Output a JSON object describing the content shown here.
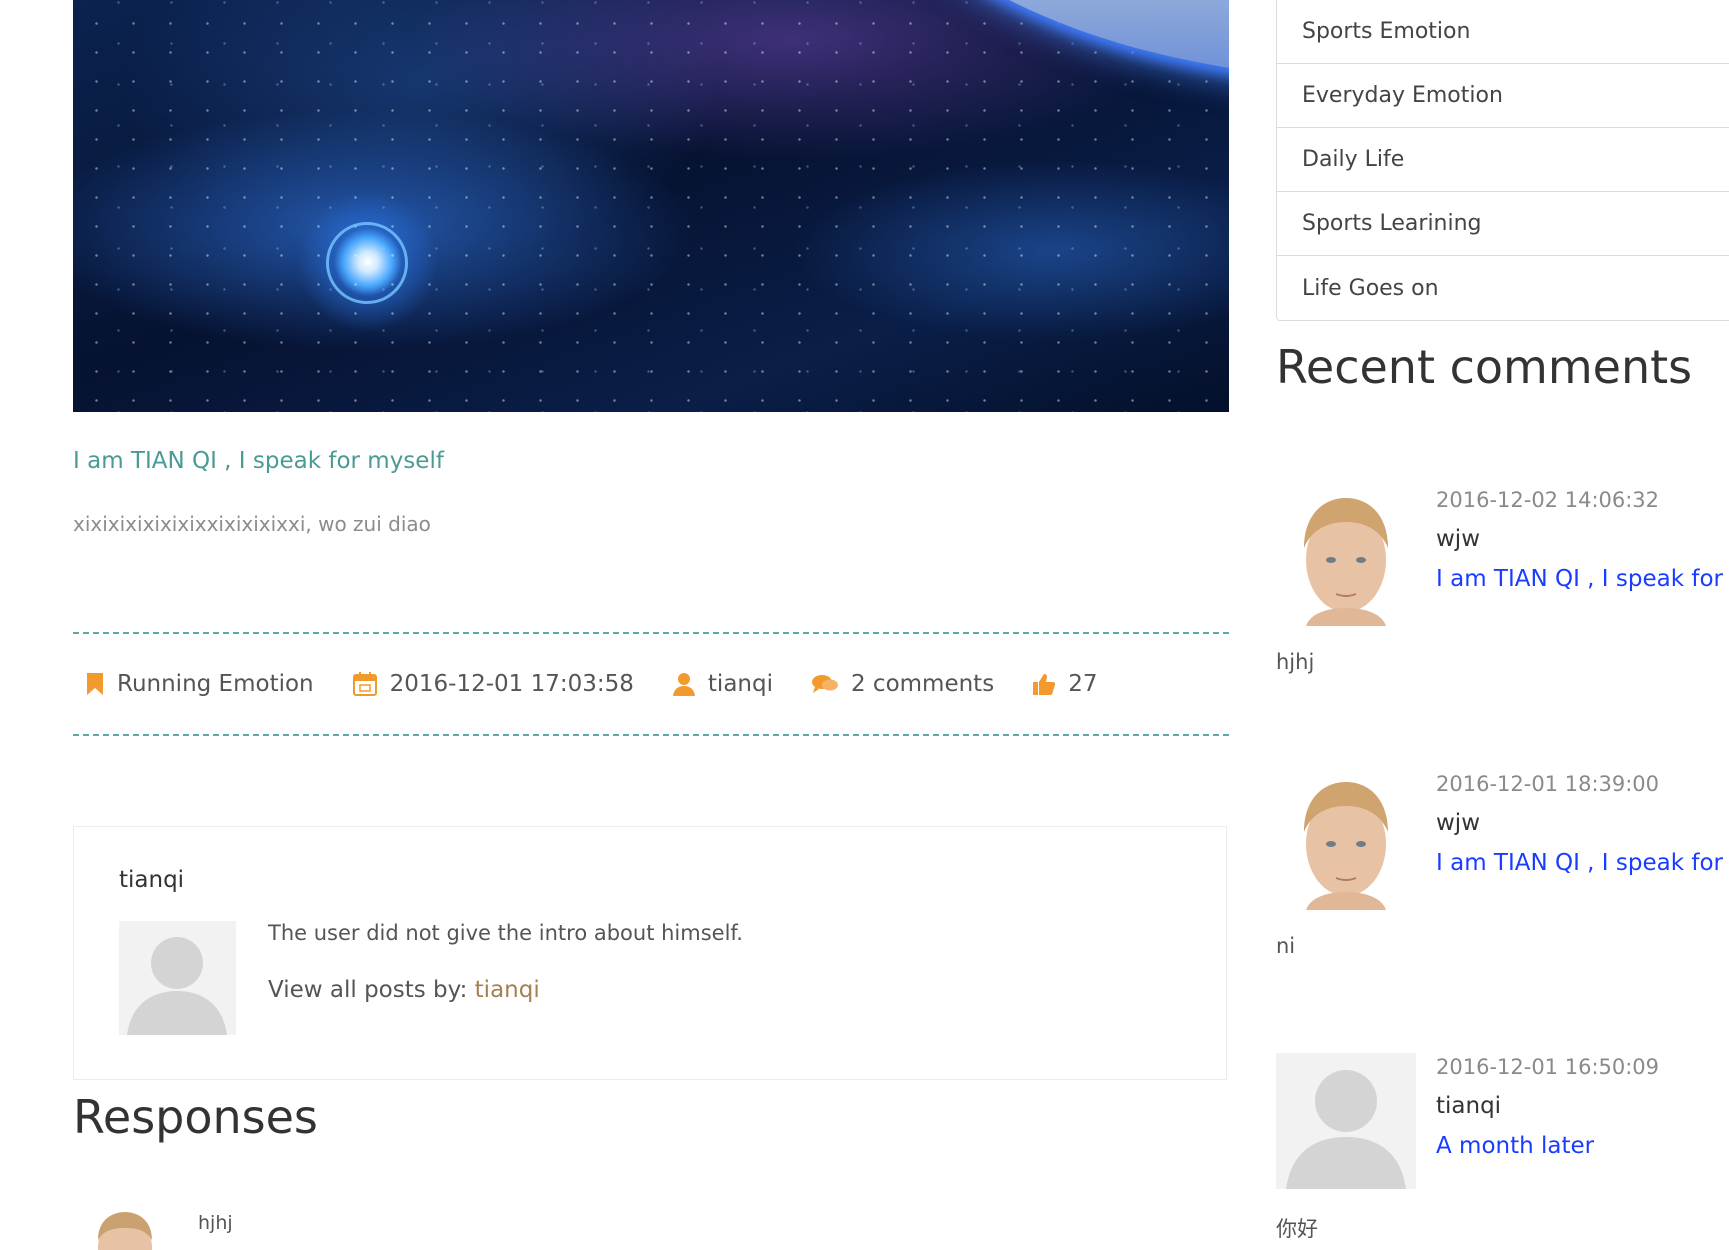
{
  "post": {
    "title": "I am TIAN QI , I speak for myself",
    "excerpt": "xixixixixixixixxixixixixxi, wo zui diao",
    "meta": {
      "category": "Running Emotion",
      "date": "2016-12-01 17:03:58",
      "author": "tianqi",
      "comments": "2 comments",
      "likes": "27"
    }
  },
  "author_box": {
    "name": "tianqi",
    "intro": "The user did not give the intro about himself.",
    "view_posts_label": "View all posts by:",
    "view_posts_link": "tianqi"
  },
  "responses": {
    "title": "Responses",
    "first_name": "hjhj"
  },
  "sidebar": {
    "categories": [
      "Sports Emotion",
      "Everyday Emotion",
      "Daily Life",
      "Sports Learining",
      "Life Goes on"
    ],
    "recent_title": "Recent comments",
    "comments": [
      {
        "date": "2016-12-02 14:06:32",
        "user": "wjw",
        "post": "I am TIAN QI , I speak for myself",
        "text": "hjhj",
        "avatar": "face"
      },
      {
        "date": "2016-12-01 18:39:00",
        "user": "wjw",
        "post": "I am TIAN QI , I speak for myself",
        "text": "ni",
        "avatar": "face"
      },
      {
        "date": "2016-12-01 16:50:09",
        "user": "tianqi",
        "post": "A month later",
        "text": "你好",
        "avatar": "silhouette"
      }
    ]
  },
  "colors": {
    "link_teal": "#4a9a96",
    "icon_orange": "#f39a2e",
    "comment_link_blue": "#1a3cff",
    "author_link_gold": "#a6804f"
  }
}
